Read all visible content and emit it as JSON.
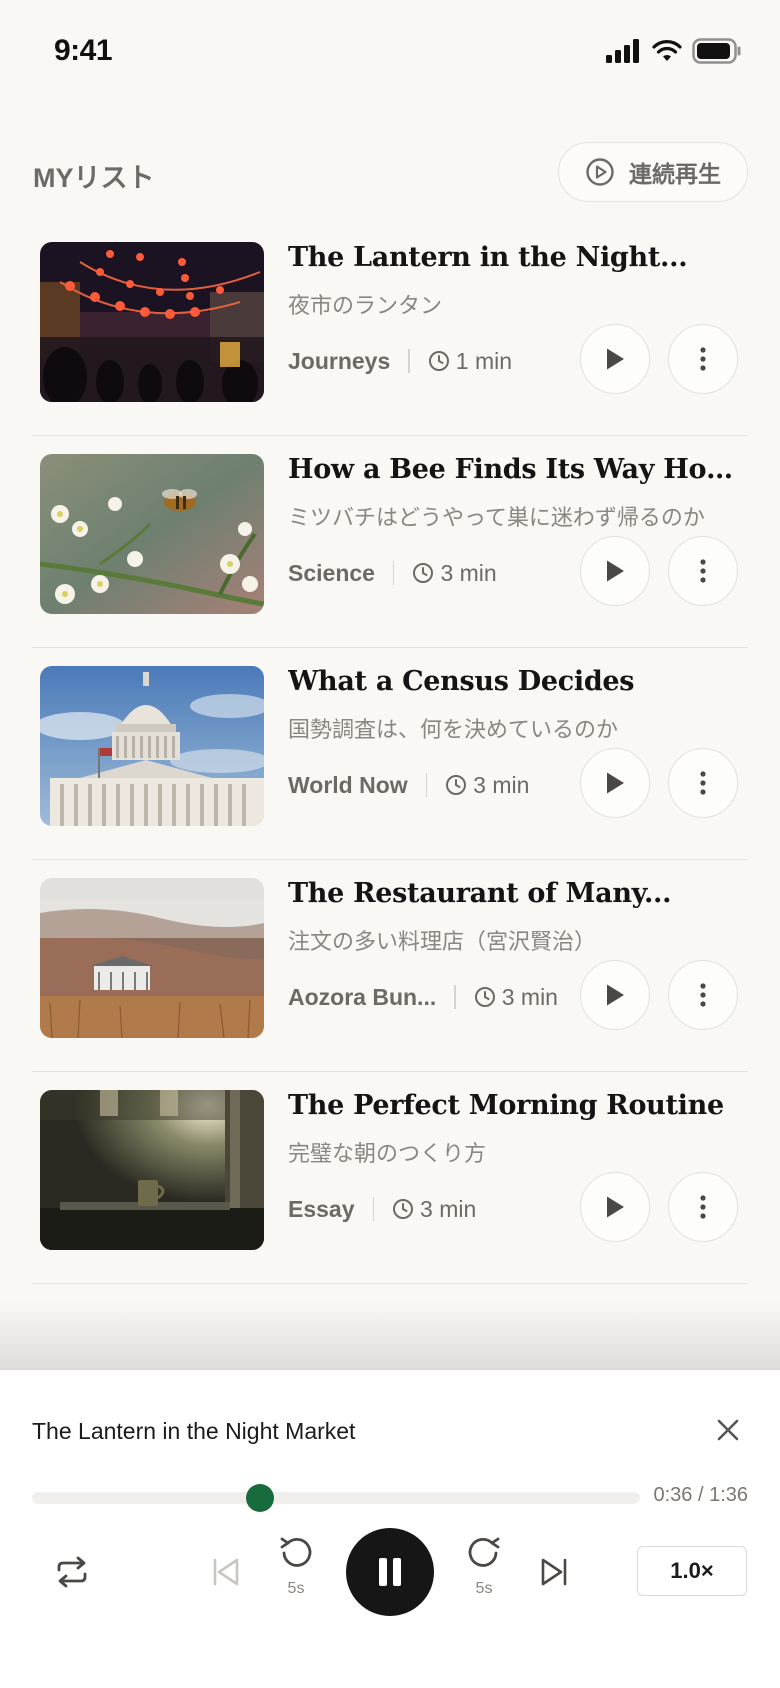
{
  "status": {
    "time": "9:41"
  },
  "header": {
    "title": "MYリスト",
    "continuous_label": "連続再生"
  },
  "tracks": [
    {
      "title": "The Lantern in the Night...",
      "subtitle": "夜市のランタン",
      "category": "Journeys",
      "duration": "1 min"
    },
    {
      "title": "How a Bee Finds Its Way Home",
      "subtitle": "ミツバチはどうやって巣に迷わず帰るのか",
      "category": "Science",
      "duration": "3 min"
    },
    {
      "title": "What a Census Decides",
      "subtitle": "国勢調査は、何を決めているのか",
      "category": "World Now",
      "duration": "3 min"
    },
    {
      "title": "The Restaurant of Many...",
      "subtitle": "注文の多い料理店（宮沢賢治）",
      "category": "Aozora Bun...",
      "duration": "3 min"
    },
    {
      "title": "The Perfect Morning Routine",
      "subtitle": "完璧な朝のつくり方",
      "category": "Essay",
      "duration": "3 min"
    }
  ],
  "player": {
    "title": "The Lantern in the Night Market",
    "time": "0:36 / 1:36",
    "progress": 0.375,
    "rewind_label": "5s",
    "forward_label": "5s",
    "speed": "1.0×",
    "accent_color": "#176b3c"
  }
}
